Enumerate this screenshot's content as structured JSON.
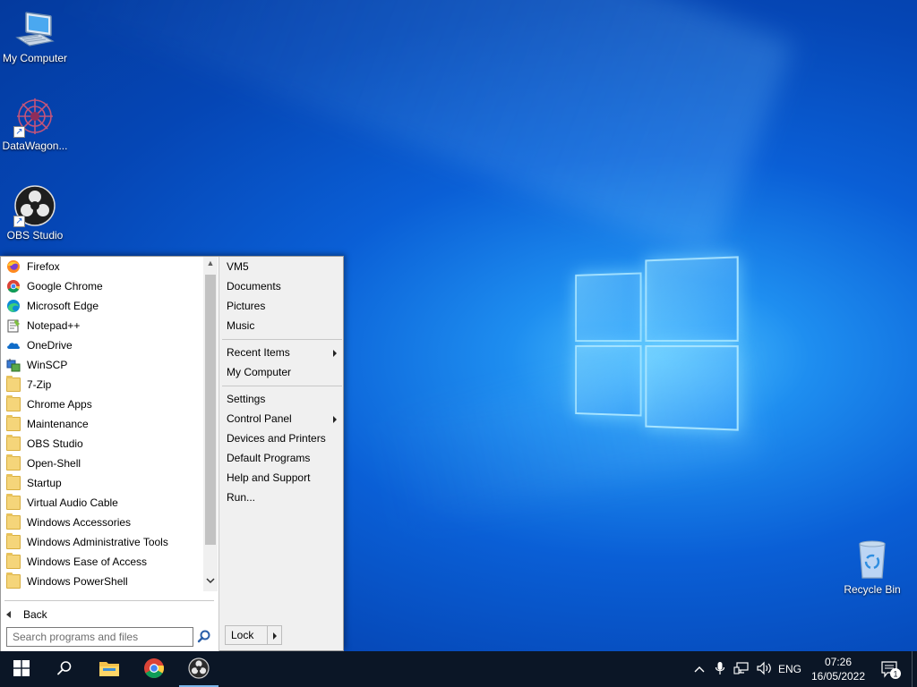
{
  "desktop": {
    "icons": [
      {
        "label": "My Computer",
        "icon": "computer-icon"
      },
      {
        "label": "DataWagon...",
        "icon": "datawagon-icon"
      },
      {
        "label": "OBS Studio",
        "icon": "obs-icon"
      },
      {
        "label": "Recycle Bin",
        "icon": "recycle-bin-icon"
      }
    ]
  },
  "start_menu": {
    "programs": [
      {
        "label": "Firefox",
        "icon": "firefox-icon"
      },
      {
        "label": "Google Chrome",
        "icon": "chrome-icon"
      },
      {
        "label": "Microsoft Edge",
        "icon": "edge-icon"
      },
      {
        "label": "Notepad++",
        "icon": "notepadpp-icon"
      },
      {
        "label": "OneDrive",
        "icon": "onedrive-icon"
      },
      {
        "label": "WinSCP",
        "icon": "winscp-icon"
      },
      {
        "label": "7-Zip",
        "icon": "folder-icon"
      },
      {
        "label": "Chrome Apps",
        "icon": "folder-icon"
      },
      {
        "label": "Maintenance",
        "icon": "folder-icon"
      },
      {
        "label": "OBS Studio",
        "icon": "folder-icon"
      },
      {
        "label": "Open-Shell",
        "icon": "folder-icon"
      },
      {
        "label": "Startup",
        "icon": "folder-icon"
      },
      {
        "label": "Virtual Audio Cable",
        "icon": "folder-icon"
      },
      {
        "label": "Windows Accessories",
        "icon": "folder-icon"
      },
      {
        "label": "Windows Administrative Tools",
        "icon": "folder-icon"
      },
      {
        "label": "Windows Ease of Access",
        "icon": "folder-icon"
      },
      {
        "label": "Windows PowerShell",
        "icon": "folder-icon"
      }
    ],
    "back_label": "Back",
    "search_placeholder": "Search programs and files",
    "right_items": {
      "vm5": "VM5",
      "documents": "Documents",
      "pictures": "Pictures",
      "music": "Music",
      "recent_items": "Recent Items",
      "my_computer": "My Computer",
      "settings": "Settings",
      "control_panel": "Control Panel",
      "devices_printers": "Devices and Printers",
      "default_programs": "Default Programs",
      "help_support": "Help and Support",
      "run": "Run..."
    },
    "lock_label": "Lock"
  },
  "taskbar": {
    "language": "ENG",
    "time": "07:26",
    "date": "16/05/2022",
    "notification_count": "1"
  },
  "colors": {
    "taskbar_bg": "#0b1626",
    "desktop_accent": "#0a5fd6"
  }
}
